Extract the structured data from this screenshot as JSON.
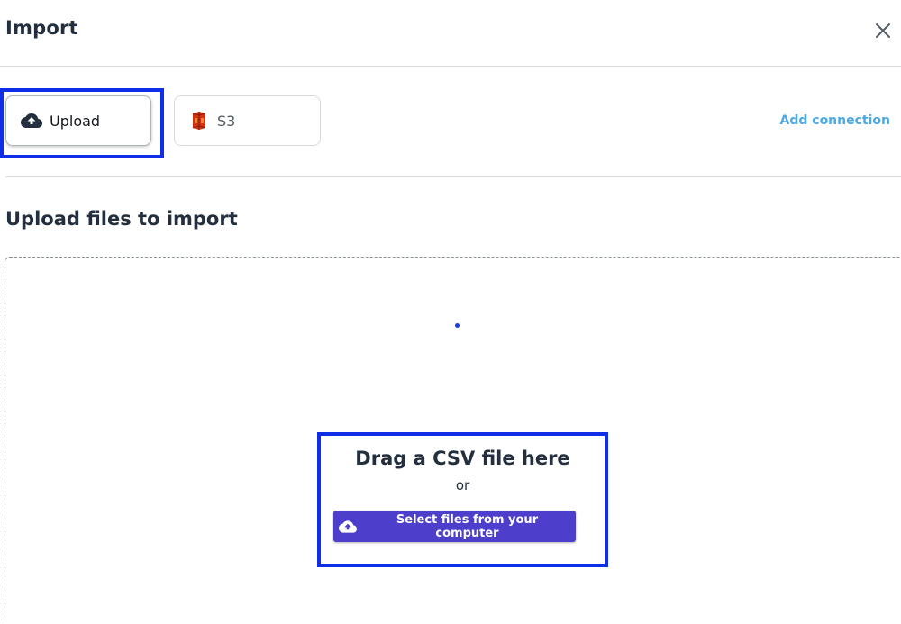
{
  "dialog": {
    "title": "Import",
    "close_icon": "close-icon"
  },
  "sources": {
    "tabs": [
      {
        "label": "Upload",
        "icon": "cloud-upload-icon",
        "selected": true
      },
      {
        "label": "S3",
        "icon": "s3-bucket-icon",
        "selected": false
      }
    ],
    "add_connection_label": "Add connection"
  },
  "upload": {
    "section_title": "Upload files to import",
    "drag_text": "Drag a CSV file here",
    "or_text": "or",
    "select_button_label": "Select files from your computer",
    "select_button_icon": "cloud-upload-icon"
  },
  "colors": {
    "primary_button": "#4d3fcc",
    "link": "#4ea8e3",
    "highlight": "#0f2ee8",
    "s3_icon": "#d13212"
  }
}
